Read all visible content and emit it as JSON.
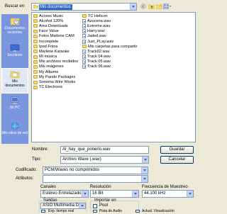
{
  "lookin": {
    "label": "Buscar en:",
    "value": "Mis documentos"
  },
  "places": [
    {
      "name": "documentos-recientes",
      "label": "Documentos recientes",
      "icon": "recent-docs-icon"
    },
    {
      "name": "escritorio",
      "label": "Escritorio",
      "icon": "desktop-icon"
    },
    {
      "name": "mis-documentos",
      "label": "Mis documentos",
      "icon": "my-documents-icon",
      "active": true
    },
    {
      "name": "mi-pc",
      "label": "Mi PC",
      "icon": "my-computer-icon"
    },
    {
      "name": "mis-sitios-de-red",
      "label": "Mis sitios de red",
      "icon": "network-places-icon"
    }
  ],
  "files": {
    "col1": [
      {
        "t": "folder",
        "label": "Access Music"
      },
      {
        "t": "folder",
        "label": "Alcohol 120%"
      },
      {
        "t": "folder",
        "label": "Ares Downloads"
      },
      {
        "t": "folder",
        "label": "Face Value"
      },
      {
        "t": "folder",
        "label": "Fotos Marlene CAM"
      },
      {
        "t": "folder",
        "label": "Incomplete"
      },
      {
        "t": "folder",
        "label": "Ipod Fotos"
      },
      {
        "t": "folder",
        "label": "Marlene Karaoke"
      },
      {
        "t": "folder",
        "label": "Mi música"
      },
      {
        "t": "folder",
        "label": "Mis archivos recibidos"
      },
      {
        "t": "folder",
        "label": "Mis imágenes"
      },
      {
        "t": "folder",
        "label": "My Albums"
      },
      {
        "t": "folder",
        "label": "My Pando Packages"
      },
      {
        "t": "folder",
        "label": "Sonoma Wire Works"
      },
      {
        "t": "folder",
        "label": "TC Electronic"
      }
    ],
    "col2": [
      {
        "t": "folder",
        "label": "TC Helicon"
      },
      {
        "t": "wave",
        "label": "Azucena.wav"
      },
      {
        "t": "wave",
        "label": "Extreme.wav"
      },
      {
        "t": "wave",
        "label": "Harry.wav"
      },
      {
        "t": "wave",
        "label": "Jaded.wav"
      },
      {
        "t": "wave",
        "label": "Just_PLay.wav"
      },
      {
        "t": "folder",
        "label": "Mis carpetas para compartir"
      },
      {
        "t": "wave",
        "label": "Track02.wav"
      },
      {
        "t": "wave",
        "label": "Track 04.wav"
      },
      {
        "t": "wave",
        "label": "Track 05.wav"
      },
      {
        "t": "wave",
        "label": "Track 06.wav"
      }
    ]
  },
  "nombre": {
    "label": "Nombre:",
    "value": "Al_hay_que_ponerlo.wav"
  },
  "tipo": {
    "label": "Tipo:",
    "value": "Archivo Wave (.wav)"
  },
  "guardar": "Guardar",
  "cancelar": "Cancelar",
  "codificado": {
    "label": "Codificado:",
    "value": "PCM/Waves no comprimidos"
  },
  "atributos": {
    "label": "Atributos:",
    "value": ""
  },
  "canales": {
    "label": "Canales",
    "value": "Estéreo Entrelazado"
  },
  "resolucion": {
    "label": "Resolución",
    "value": "16 Bit"
  },
  "frecuencia": {
    "label": "Frecuencia de Muestreo",
    "value": "44.100 kHz"
  },
  "salidas": {
    "label": "Salidas",
    "value": "ASIO Multimedia Driv",
    "exp_label": "Exp. tiempo real"
  },
  "importar": {
    "label": "Importar en",
    "pool_label": "Pool",
    "pista_label": "Pista de Audio"
  },
  "actual": {
    "label": "Actual. Visualización"
  }
}
